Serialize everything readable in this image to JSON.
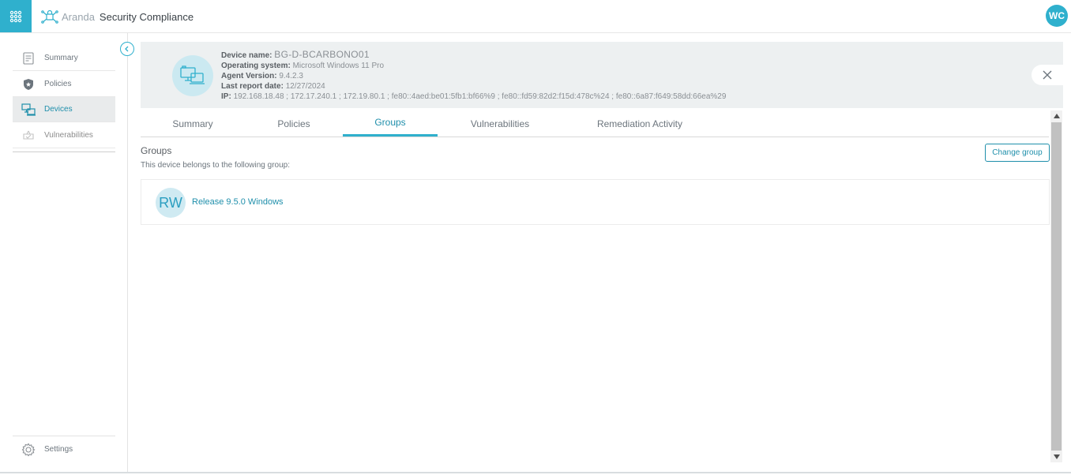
{
  "header": {
    "brand_name": "Aranda",
    "brand_product": "Security Compliance",
    "user_initials": "WC"
  },
  "sidebar": {
    "items": [
      {
        "label": "Summary"
      },
      {
        "label": "Policies"
      },
      {
        "label": "Devices"
      },
      {
        "label": "Vulnerabilities"
      }
    ],
    "settings_label": "Settings"
  },
  "device": {
    "name_label": "Device name:",
    "name": "BG-D-BCARBONO01",
    "os_label": "Operating system:",
    "os": "Microsoft Windows 11 Pro",
    "agent_label": "Agent Version:",
    "agent": "9.4.2.3",
    "report_label": "Last report date:",
    "report": "12/27/2024",
    "ip_label": "IP:",
    "ip": "192.168.18.48 ; 172.17.240.1 ; 172.19.80.1 ; fe80::4aed:be01:5fb1:bf66%9 ; fe80::fd59:82d2:f15d:478c%24 ; fe80::6a87:f649:58dd:66ea%29"
  },
  "tabs": [
    {
      "label": "Summary"
    },
    {
      "label": "Policies"
    },
    {
      "label": "Groups"
    },
    {
      "label": "Vulnerabilities"
    },
    {
      "label": "Remediation Activity"
    }
  ],
  "groups": {
    "title": "Groups",
    "subtitle": "This device belongs to the following group:",
    "change_button": "Change group",
    "items": [
      {
        "initials": "RW",
        "name": "Release 9.5.0 Windows"
      }
    ]
  },
  "colors": {
    "accent": "#2fb0cd",
    "accent_dark": "#1f8fab",
    "header_bg": "#edf0f1"
  }
}
